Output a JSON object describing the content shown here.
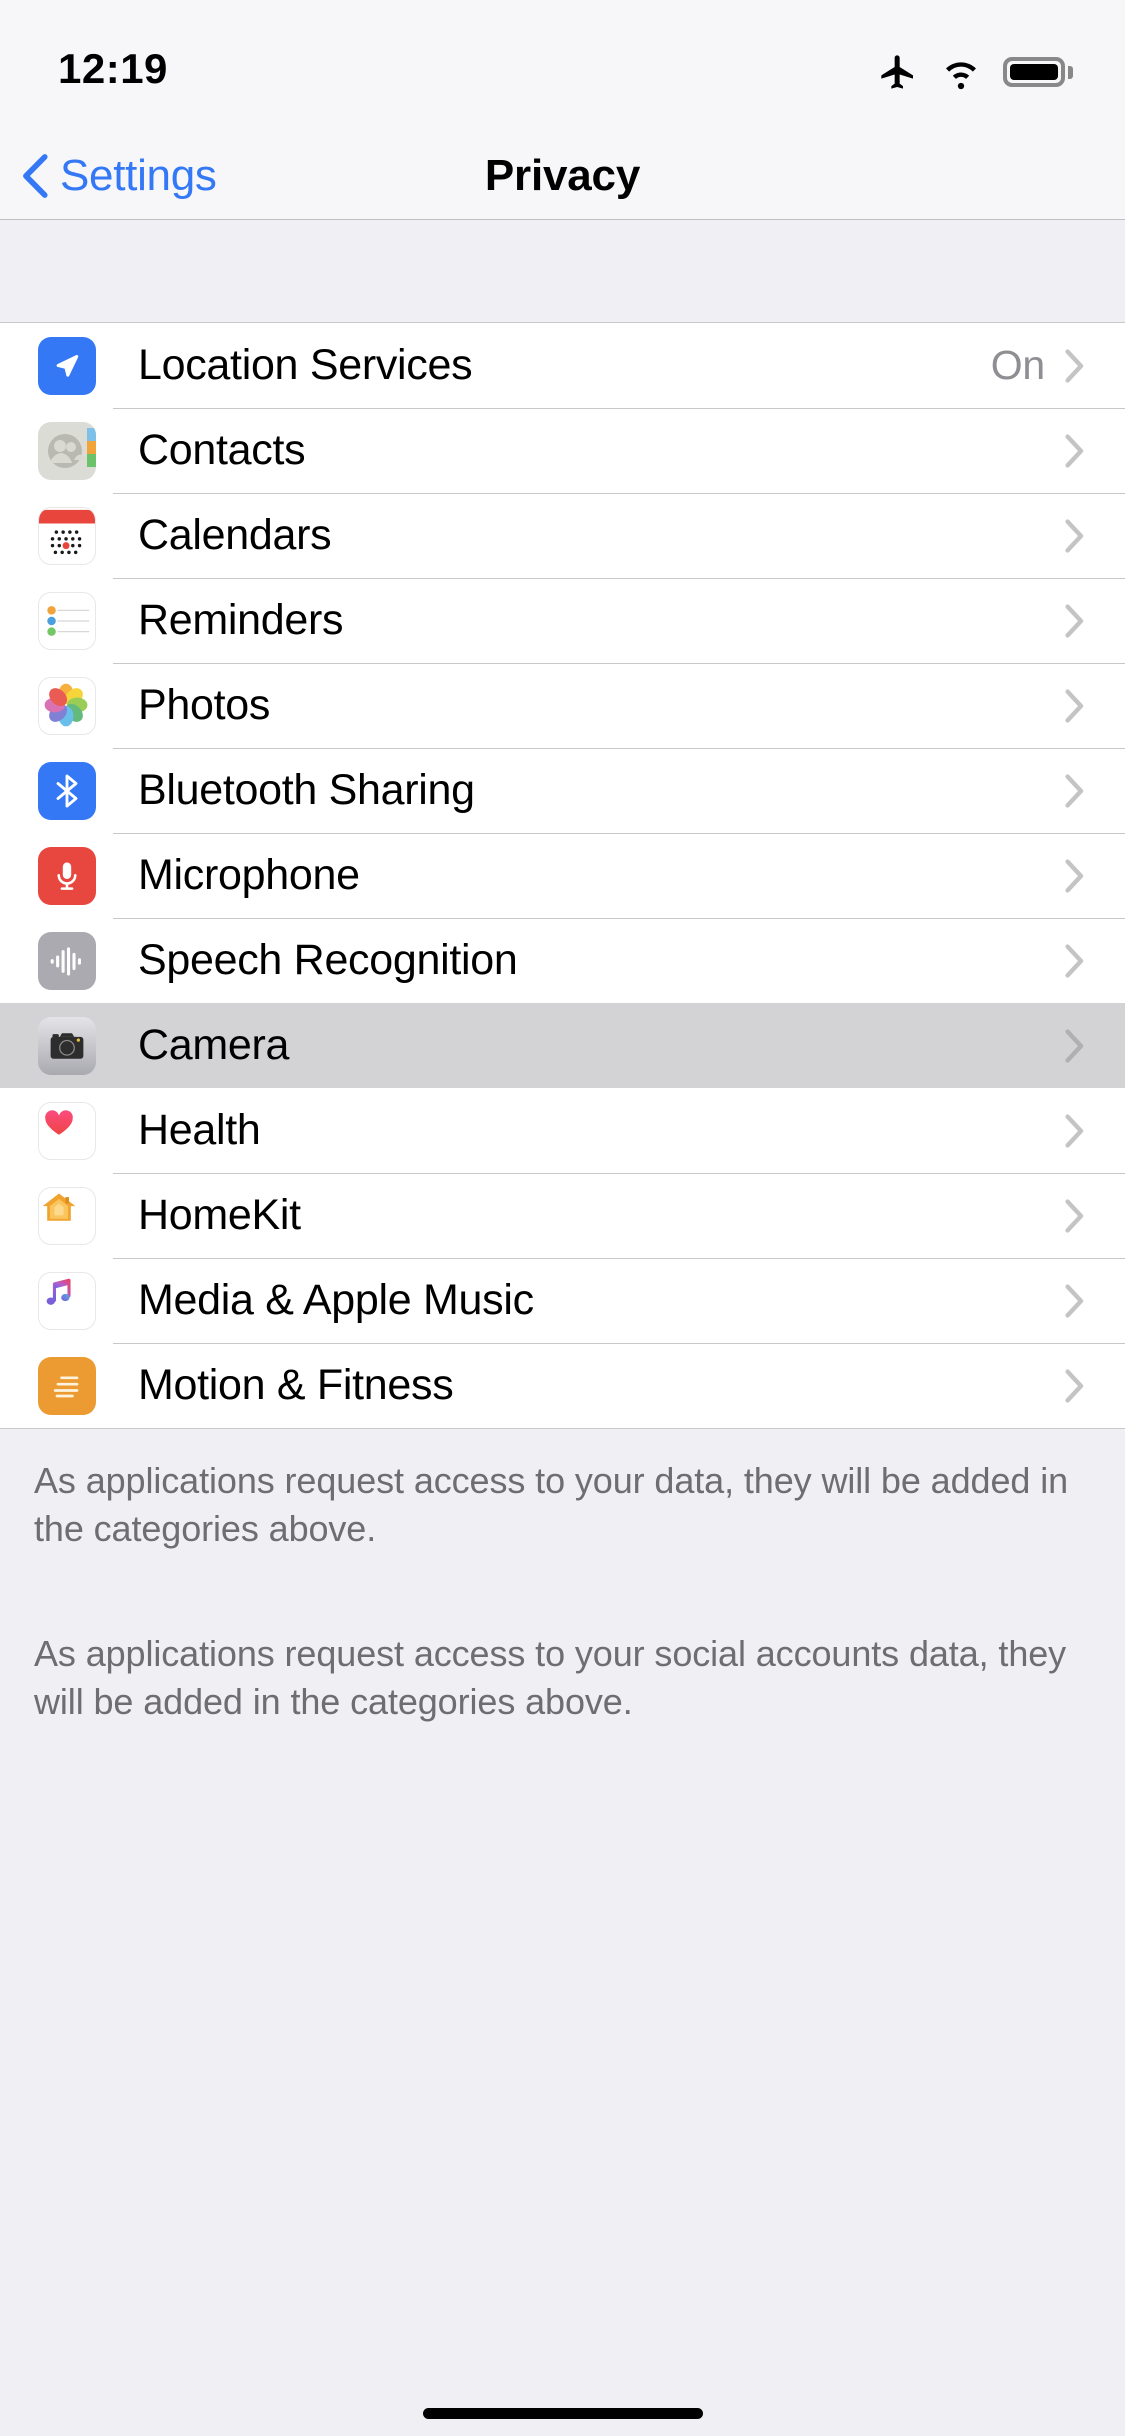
{
  "status_bar": {
    "time": "12:19",
    "icons": [
      "airplane-mode-icon",
      "wifi-icon",
      "battery-icon"
    ]
  },
  "nav": {
    "back_label": "Settings",
    "title": "Privacy"
  },
  "list": {
    "rows": [
      {
        "label": "Location Services",
        "value": "On",
        "icon": "location-arrow-icon",
        "selected": false
      },
      {
        "label": "Contacts",
        "value": "",
        "icon": "contacts-icon",
        "selected": false
      },
      {
        "label": "Calendars",
        "value": "",
        "icon": "calendar-icon",
        "selected": false
      },
      {
        "label": "Reminders",
        "value": "",
        "icon": "reminders-icon",
        "selected": false
      },
      {
        "label": "Photos",
        "value": "",
        "icon": "photos-icon",
        "selected": false
      },
      {
        "label": "Bluetooth Sharing",
        "value": "",
        "icon": "bluetooth-icon",
        "selected": false
      },
      {
        "label": "Microphone",
        "value": "",
        "icon": "microphone-icon",
        "selected": false
      },
      {
        "label": "Speech Recognition",
        "value": "",
        "icon": "speech-waveform-icon",
        "selected": false
      },
      {
        "label": "Camera",
        "value": "",
        "icon": "camera-icon",
        "selected": true
      },
      {
        "label": "Health",
        "value": "",
        "icon": "heart-icon",
        "selected": false
      },
      {
        "label": "HomeKit",
        "value": "",
        "icon": "house-icon",
        "selected": false
      },
      {
        "label": "Media & Apple Music",
        "value": "",
        "icon": "music-note-icon",
        "selected": false
      },
      {
        "label": "Motion & Fitness",
        "value": "",
        "icon": "motion-lines-icon",
        "selected": false
      }
    ]
  },
  "footers": {
    "first": "As applications request access to your data, they will be added in the categories above.",
    "second": "As applications request access to your social accounts data, they will be added in the categories above."
  },
  "colors": {
    "accent_blue": "#3478f6",
    "row_selected": "#d3d3d6",
    "group_background": "#efeff4",
    "separator": "#c8c7cc",
    "secondary_text": "#8e8e93",
    "footer_text": "#6d6d72"
  }
}
